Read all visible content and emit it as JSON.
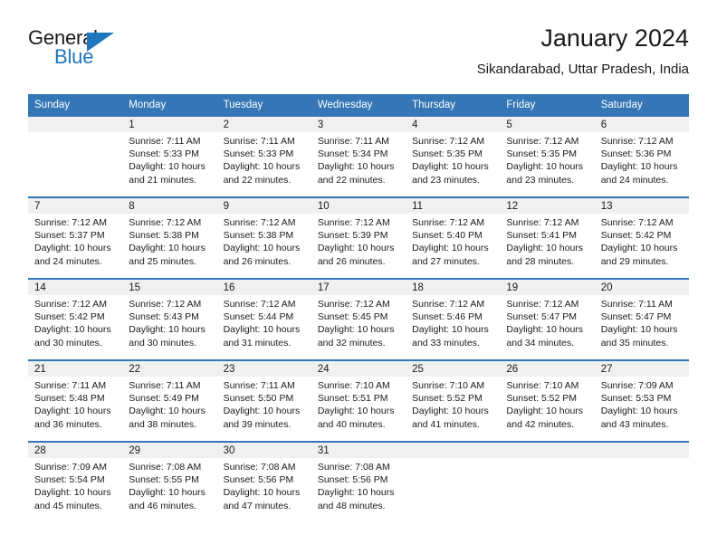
{
  "brand": {
    "name_part1": "General",
    "name_part2": "Blue",
    "logo_icon": "triangle-icon",
    "colors": {
      "blue": "#1f76bc",
      "dark": "#1a1a1a"
    }
  },
  "header": {
    "title": "January 2024",
    "location": "Sikandarabad, Uttar Pradesh, India",
    "header_bg": "#3476b6",
    "daynum_bg": "#f0f0f0"
  },
  "weekdays": [
    "Sunday",
    "Monday",
    "Tuesday",
    "Wednesday",
    "Thursday",
    "Friday",
    "Saturday"
  ],
  "weeks": [
    [
      {
        "day": "",
        "sunrise": "",
        "sunset": "",
        "daylight_line1": "",
        "daylight_line2": "",
        "empty": true
      },
      {
        "day": "1",
        "sunrise": "Sunrise: 7:11 AM",
        "sunset": "Sunset: 5:33 PM",
        "daylight_line1": "Daylight: 10 hours",
        "daylight_line2": "and 21 minutes.",
        "empty": false
      },
      {
        "day": "2",
        "sunrise": "Sunrise: 7:11 AM",
        "sunset": "Sunset: 5:33 PM",
        "daylight_line1": "Daylight: 10 hours",
        "daylight_line2": "and 22 minutes.",
        "empty": false
      },
      {
        "day": "3",
        "sunrise": "Sunrise: 7:11 AM",
        "sunset": "Sunset: 5:34 PM",
        "daylight_line1": "Daylight: 10 hours",
        "daylight_line2": "and 22 minutes.",
        "empty": false
      },
      {
        "day": "4",
        "sunrise": "Sunrise: 7:12 AM",
        "sunset": "Sunset: 5:35 PM",
        "daylight_line1": "Daylight: 10 hours",
        "daylight_line2": "and 23 minutes.",
        "empty": false
      },
      {
        "day": "5",
        "sunrise": "Sunrise: 7:12 AM",
        "sunset": "Sunset: 5:35 PM",
        "daylight_line1": "Daylight: 10 hours",
        "daylight_line2": "and 23 minutes.",
        "empty": false
      },
      {
        "day": "6",
        "sunrise": "Sunrise: 7:12 AM",
        "sunset": "Sunset: 5:36 PM",
        "daylight_line1": "Daylight: 10 hours",
        "daylight_line2": "and 24 minutes.",
        "empty": false
      }
    ],
    [
      {
        "day": "7",
        "sunrise": "Sunrise: 7:12 AM",
        "sunset": "Sunset: 5:37 PM",
        "daylight_line1": "Daylight: 10 hours",
        "daylight_line2": "and 24 minutes.",
        "empty": false
      },
      {
        "day": "8",
        "sunrise": "Sunrise: 7:12 AM",
        "sunset": "Sunset: 5:38 PM",
        "daylight_line1": "Daylight: 10 hours",
        "daylight_line2": "and 25 minutes.",
        "empty": false
      },
      {
        "day": "9",
        "sunrise": "Sunrise: 7:12 AM",
        "sunset": "Sunset: 5:38 PM",
        "daylight_line1": "Daylight: 10 hours",
        "daylight_line2": "and 26 minutes.",
        "empty": false
      },
      {
        "day": "10",
        "sunrise": "Sunrise: 7:12 AM",
        "sunset": "Sunset: 5:39 PM",
        "daylight_line1": "Daylight: 10 hours",
        "daylight_line2": "and 26 minutes.",
        "empty": false
      },
      {
        "day": "11",
        "sunrise": "Sunrise: 7:12 AM",
        "sunset": "Sunset: 5:40 PM",
        "daylight_line1": "Daylight: 10 hours",
        "daylight_line2": "and 27 minutes.",
        "empty": false
      },
      {
        "day": "12",
        "sunrise": "Sunrise: 7:12 AM",
        "sunset": "Sunset: 5:41 PM",
        "daylight_line1": "Daylight: 10 hours",
        "daylight_line2": "and 28 minutes.",
        "empty": false
      },
      {
        "day": "13",
        "sunrise": "Sunrise: 7:12 AM",
        "sunset": "Sunset: 5:42 PM",
        "daylight_line1": "Daylight: 10 hours",
        "daylight_line2": "and 29 minutes.",
        "empty": false
      }
    ],
    [
      {
        "day": "14",
        "sunrise": "Sunrise: 7:12 AM",
        "sunset": "Sunset: 5:42 PM",
        "daylight_line1": "Daylight: 10 hours",
        "daylight_line2": "and 30 minutes.",
        "empty": false
      },
      {
        "day": "15",
        "sunrise": "Sunrise: 7:12 AM",
        "sunset": "Sunset: 5:43 PM",
        "daylight_line1": "Daylight: 10 hours",
        "daylight_line2": "and 30 minutes.",
        "empty": false
      },
      {
        "day": "16",
        "sunrise": "Sunrise: 7:12 AM",
        "sunset": "Sunset: 5:44 PM",
        "daylight_line1": "Daylight: 10 hours",
        "daylight_line2": "and 31 minutes.",
        "empty": false
      },
      {
        "day": "17",
        "sunrise": "Sunrise: 7:12 AM",
        "sunset": "Sunset: 5:45 PM",
        "daylight_line1": "Daylight: 10 hours",
        "daylight_line2": "and 32 minutes.",
        "empty": false
      },
      {
        "day": "18",
        "sunrise": "Sunrise: 7:12 AM",
        "sunset": "Sunset: 5:46 PM",
        "daylight_line1": "Daylight: 10 hours",
        "daylight_line2": "and 33 minutes.",
        "empty": false
      },
      {
        "day": "19",
        "sunrise": "Sunrise: 7:12 AM",
        "sunset": "Sunset: 5:47 PM",
        "daylight_line1": "Daylight: 10 hours",
        "daylight_line2": "and 34 minutes.",
        "empty": false
      },
      {
        "day": "20",
        "sunrise": "Sunrise: 7:11 AM",
        "sunset": "Sunset: 5:47 PM",
        "daylight_line1": "Daylight: 10 hours",
        "daylight_line2": "and 35 minutes.",
        "empty": false
      }
    ],
    [
      {
        "day": "21",
        "sunrise": "Sunrise: 7:11 AM",
        "sunset": "Sunset: 5:48 PM",
        "daylight_line1": "Daylight: 10 hours",
        "daylight_line2": "and 36 minutes.",
        "empty": false
      },
      {
        "day": "22",
        "sunrise": "Sunrise: 7:11 AM",
        "sunset": "Sunset: 5:49 PM",
        "daylight_line1": "Daylight: 10 hours",
        "daylight_line2": "and 38 minutes.",
        "empty": false
      },
      {
        "day": "23",
        "sunrise": "Sunrise: 7:11 AM",
        "sunset": "Sunset: 5:50 PM",
        "daylight_line1": "Daylight: 10 hours",
        "daylight_line2": "and 39 minutes.",
        "empty": false
      },
      {
        "day": "24",
        "sunrise": "Sunrise: 7:10 AM",
        "sunset": "Sunset: 5:51 PM",
        "daylight_line1": "Daylight: 10 hours",
        "daylight_line2": "and 40 minutes.",
        "empty": false
      },
      {
        "day": "25",
        "sunrise": "Sunrise: 7:10 AM",
        "sunset": "Sunset: 5:52 PM",
        "daylight_line1": "Daylight: 10 hours",
        "daylight_line2": "and 41 minutes.",
        "empty": false
      },
      {
        "day": "26",
        "sunrise": "Sunrise: 7:10 AM",
        "sunset": "Sunset: 5:52 PM",
        "daylight_line1": "Daylight: 10 hours",
        "daylight_line2": "and 42 minutes.",
        "empty": false
      },
      {
        "day": "27",
        "sunrise": "Sunrise: 7:09 AM",
        "sunset": "Sunset: 5:53 PM",
        "daylight_line1": "Daylight: 10 hours",
        "daylight_line2": "and 43 minutes.",
        "empty": false
      }
    ],
    [
      {
        "day": "28",
        "sunrise": "Sunrise: 7:09 AM",
        "sunset": "Sunset: 5:54 PM",
        "daylight_line1": "Daylight: 10 hours",
        "daylight_line2": "and 45 minutes.",
        "empty": false
      },
      {
        "day": "29",
        "sunrise": "Sunrise: 7:08 AM",
        "sunset": "Sunset: 5:55 PM",
        "daylight_line1": "Daylight: 10 hours",
        "daylight_line2": "and 46 minutes.",
        "empty": false
      },
      {
        "day": "30",
        "sunrise": "Sunrise: 7:08 AM",
        "sunset": "Sunset: 5:56 PM",
        "daylight_line1": "Daylight: 10 hours",
        "daylight_line2": "and 47 minutes.",
        "empty": false
      },
      {
        "day": "31",
        "sunrise": "Sunrise: 7:08 AM",
        "sunset": "Sunset: 5:56 PM",
        "daylight_line1": "Daylight: 10 hours",
        "daylight_line2": "and 48 minutes.",
        "empty": false
      },
      {
        "day": "",
        "sunrise": "",
        "sunset": "",
        "daylight_line1": "",
        "daylight_line2": "",
        "empty": true
      },
      {
        "day": "",
        "sunrise": "",
        "sunset": "",
        "daylight_line1": "",
        "daylight_line2": "",
        "empty": true
      },
      {
        "day": "",
        "sunrise": "",
        "sunset": "",
        "daylight_line1": "",
        "daylight_line2": "",
        "empty": true
      }
    ]
  ]
}
